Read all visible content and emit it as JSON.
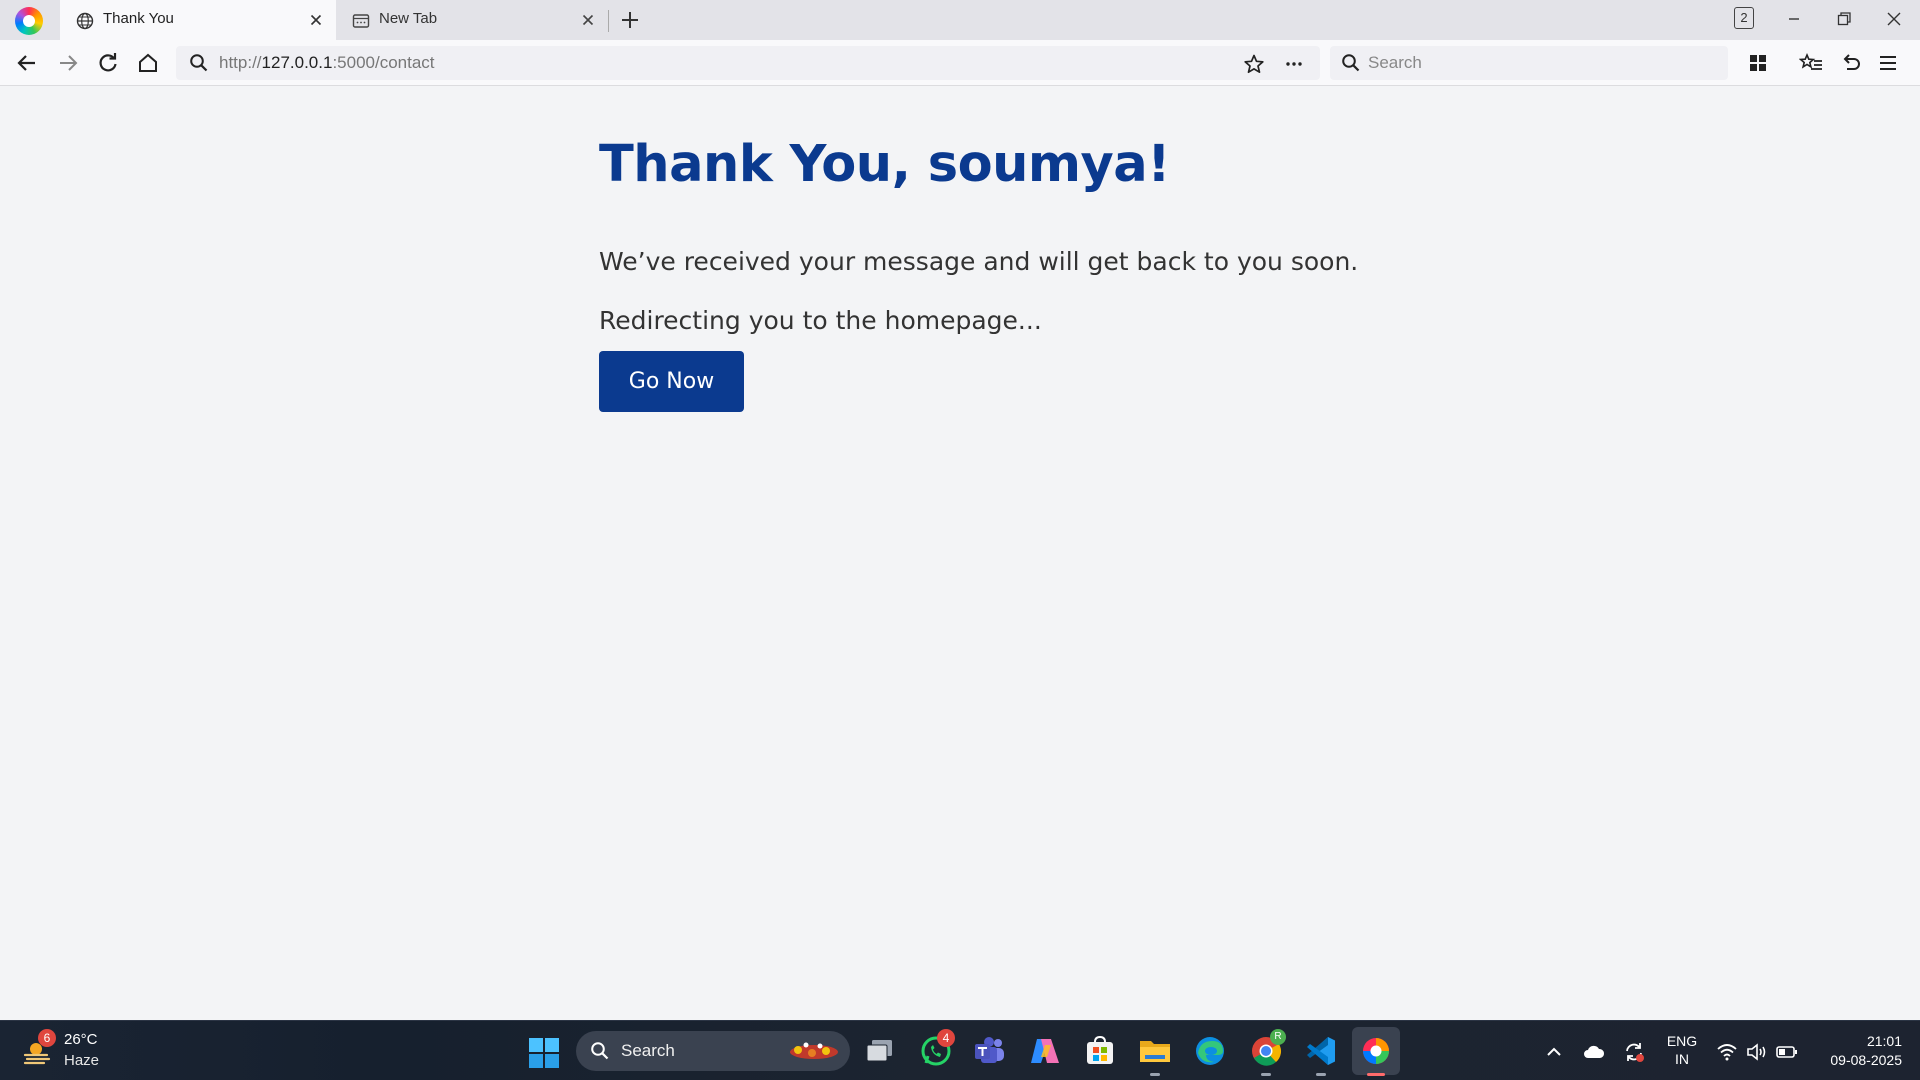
{
  "browser": {
    "tabs": [
      {
        "title": "Thank You",
        "icon": "globe-icon",
        "active": true
      },
      {
        "title": "New Tab",
        "icon": "new-tab-page-icon",
        "active": false
      }
    ],
    "tab_count": "2",
    "address": {
      "scheme": "http://",
      "host": "127.0.0.1",
      "rest": ":5000/contact"
    },
    "search_placeholder": "Search"
  },
  "page": {
    "heading": "Thank You, soumya!",
    "message": "We’ve received your message and will get back to you soon.",
    "redirect": "Redirecting you to the homepage...",
    "button_label": "Go Now",
    "colors": {
      "primary": "#0b3a8f",
      "background": "#f3f4f6",
      "text": "#333333"
    }
  },
  "taskbar": {
    "weather": {
      "badge": "6",
      "temp": "26°C",
      "condition": "Haze"
    },
    "search_label": "Search",
    "apps": [
      {
        "name": "task-view-icon"
      },
      {
        "name": "whatsapp-icon",
        "badge": "4"
      },
      {
        "name": "teams-icon"
      },
      {
        "name": "copilot-icon"
      },
      {
        "name": "microsoft-store-icon"
      },
      {
        "name": "file-explorer-icon"
      },
      {
        "name": "edge-icon"
      },
      {
        "name": "chrome-icon"
      },
      {
        "name": "vscode-icon"
      },
      {
        "name": "browser-icon"
      }
    ],
    "lang": {
      "line1": "ENG",
      "line2": "IN"
    },
    "clock": {
      "time": "21:01",
      "date": "09-08-2025"
    }
  }
}
